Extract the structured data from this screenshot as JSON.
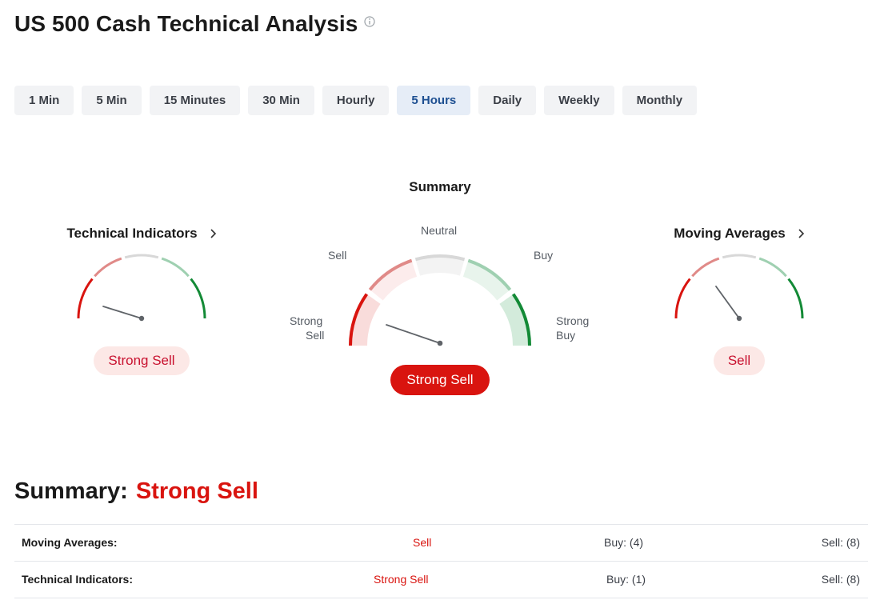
{
  "page": {
    "title": "US 500 Cash Technical Analysis"
  },
  "tabs": [
    {
      "label": "1 Min",
      "active": false
    },
    {
      "label": "5 Min",
      "active": false
    },
    {
      "label": "15 Minutes",
      "active": false
    },
    {
      "label": "30 Min",
      "active": false
    },
    {
      "label": "Hourly",
      "active": false
    },
    {
      "label": "5 Hours",
      "active": true
    },
    {
      "label": "Daily",
      "active": false
    },
    {
      "label": "Weekly",
      "active": false
    },
    {
      "label": "Monthly",
      "active": false
    }
  ],
  "gauges": {
    "technical_indicators": {
      "title": "Technical Indicators",
      "verdict": "Strong Sell"
    },
    "summary": {
      "title": "Summary",
      "verdict": "Strong Sell",
      "labels": {
        "strong_sell_1": "Strong",
        "strong_sell_2": "Sell",
        "sell": "Sell",
        "neutral": "Neutral",
        "buy": "Buy",
        "strong_buy_1": "Strong",
        "strong_buy_2": "Buy"
      }
    },
    "moving_averages": {
      "title": "Moving Averages",
      "verdict": "Sell"
    }
  },
  "summary_section": {
    "label": "Summary:",
    "verdict": "Strong Sell"
  },
  "table": {
    "rows": [
      {
        "name": "Moving Averages:",
        "action": "Sell",
        "buys": "Buy: (4)",
        "sells": "Sell: (8)"
      },
      {
        "name": "Technical Indicators:",
        "action": "Strong Sell",
        "buys": "Buy: (1)",
        "sells": "Sell: (8)"
      }
    ]
  },
  "colors": {
    "strong_sell": "#d9140f",
    "sell": "#e08a88",
    "neutral": "#d8d8d8",
    "buy": "#9fd0b1",
    "strong_buy": "#138a36",
    "active_tab_text": "#1d4f91"
  },
  "icons": {
    "info": "info-icon",
    "chevron": "chevron-right-icon"
  }
}
